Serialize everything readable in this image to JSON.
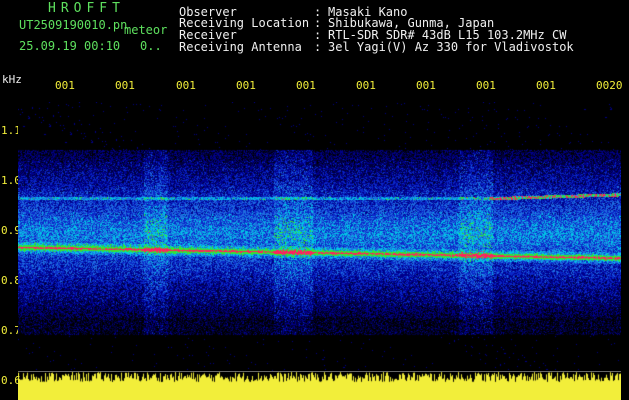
{
  "header": {
    "title": "HROFFT",
    "filename": "UT2509190010.pn",
    "mode": "meteor",
    "datetime": "25.09.19 00:10",
    "counter": "0..",
    "info": [
      {
        "label": "Observer",
        "value": "Masaki Kano"
      },
      {
        "label": "Receiving Location",
        "value": "Shibukawa, Gunma, Japan"
      },
      {
        "label": "Receiver",
        "value": "RTL-SDR SDR# 43dB L15 103.2MHz CW"
      },
      {
        "label": "Receiving Antenna",
        "value": "3el Yagi(V) Az 330 for Vladivostok"
      }
    ]
  },
  "axis": {
    "unit": "kHz",
    "time_ticks": [
      "001",
      "001",
      "001",
      "001",
      "001",
      "001",
      "001",
      "001",
      "001",
      "0020"
    ],
    "freq_ticks": [
      "1.1",
      "1.0",
      "0.9",
      "0.8",
      "0.7",
      "0.6"
    ]
  },
  "colors": {
    "background": "#000000",
    "noise_low": "#00008b",
    "noise_mid": "#1e6fe0",
    "noise_high": "#00e0e0",
    "signal_green": "#32e632",
    "signal_peak": "#ff2060",
    "amplitude": "#f2ee3a"
  }
}
